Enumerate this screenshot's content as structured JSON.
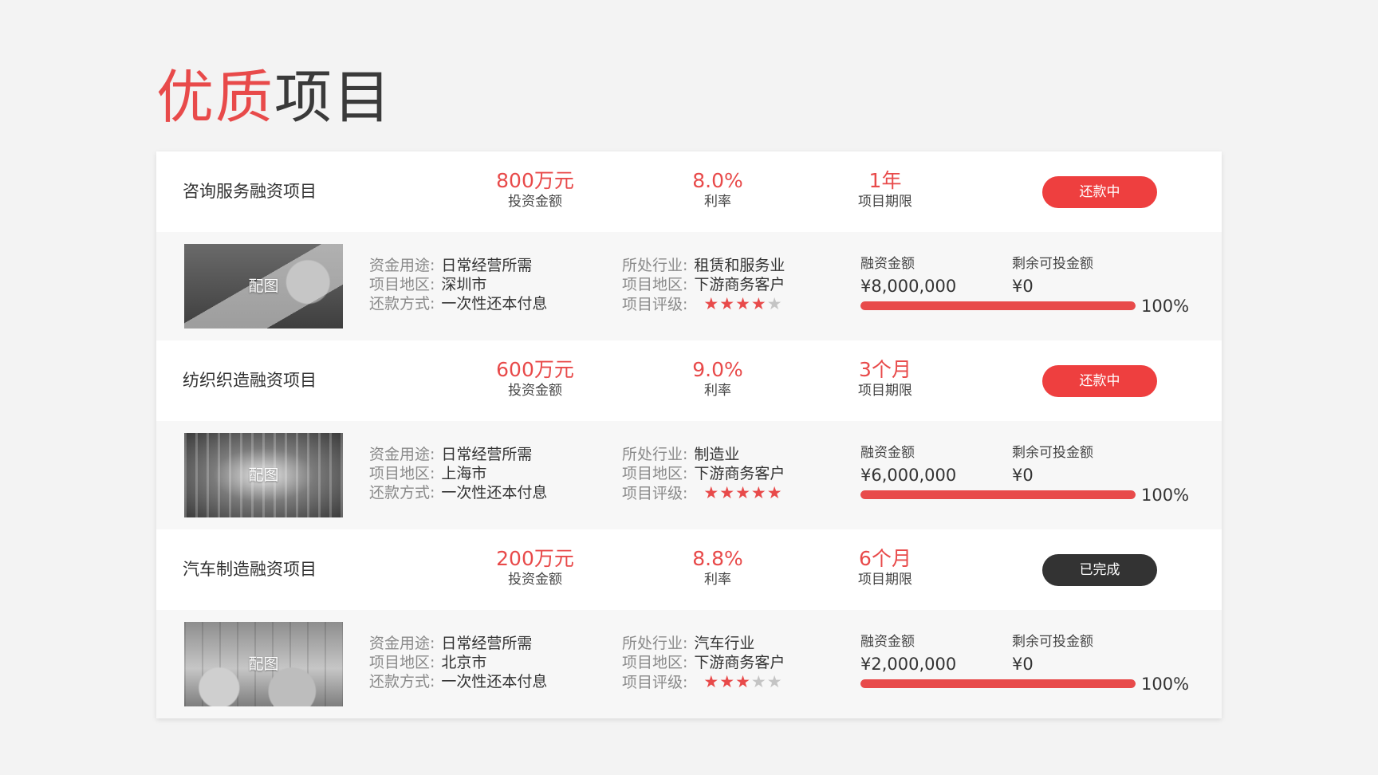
{
  "title": {
    "accent": "优质",
    "rest": "项目"
  },
  "projects": [
    {
      "name": "咨询服务融资项目",
      "amount": {
        "value": "800万元",
        "caption": "投资金额"
      },
      "rate": {
        "value": "8.0%",
        "caption": "利率"
      },
      "term": {
        "value": "1年",
        "caption": "项目期限"
      },
      "status": "还款中",
      "status_type": "active",
      "image_label": "配图",
      "purpose": {
        "key": "资金用途",
        "sep": ":",
        "value": "日常经营所需"
      },
      "region": {
        "key": "项目地区",
        "sep": ":",
        "value": "深圳市"
      },
      "repayment": {
        "key": "还款方式",
        "sep": ":",
        "value": "一次性还本付息"
      },
      "industry": {
        "key": "所处行业",
        "sep": ":",
        "value": "租赁和服务业"
      },
      "region2": {
        "key": "项目地区",
        "sep": ":",
        "value": "下游商务客户"
      },
      "rating": {
        "key": "项目评级",
        "sep": ":",
        "stars": 4,
        "max": 5
      },
      "financing_label": "融资金额",
      "financing_value": "¥8,000,000",
      "remaining_label": "剩余可投金额",
      "remaining_value": "¥0",
      "progress": 100,
      "progress_text": "100%"
    },
    {
      "name": "纺织织造融资项目",
      "amount": {
        "value": "600万元",
        "caption": "投资金额"
      },
      "rate": {
        "value": "9.0%",
        "caption": "利率"
      },
      "term": {
        "value": "3个月",
        "caption": "项目期限"
      },
      "status": "还款中",
      "status_type": "active",
      "image_label": "配图",
      "purpose": {
        "key": "资金用途",
        "sep": ":",
        "value": "日常经营所需"
      },
      "region": {
        "key": "项目地区",
        "sep": ":",
        "value": "上海市"
      },
      "repayment": {
        "key": "还款方式",
        "sep": ":",
        "value": "一次性还本付息"
      },
      "industry": {
        "key": "所处行业",
        "sep": ":",
        "value": "制造业"
      },
      "region2": {
        "key": "项目地区",
        "sep": ":",
        "value": "下游商务客户"
      },
      "rating": {
        "key": "项目评级",
        "sep": ":",
        "stars": 5,
        "max": 5
      },
      "financing_label": "融资金额",
      "financing_value": "¥6,000,000",
      "remaining_label": "剩余可投金额",
      "remaining_value": "¥0",
      "progress": 100,
      "progress_text": "100%"
    },
    {
      "name": "汽车制造融资项目",
      "amount": {
        "value": "200万元",
        "caption": "投资金额"
      },
      "rate": {
        "value": "8.8%",
        "caption": "利率"
      },
      "term": {
        "value": "6个月",
        "caption": "项目期限"
      },
      "status": "已完成",
      "status_type": "done",
      "image_label": "配图",
      "purpose": {
        "key": "资金用途",
        "sep": ":",
        "value": "日常经营所需"
      },
      "region": {
        "key": "项目地区",
        "sep": ":",
        "value": "北京市"
      },
      "repayment": {
        "key": "还款方式",
        "sep": ":",
        "value": "一次性还本付息"
      },
      "industry": {
        "key": "所处行业",
        "sep": ":",
        "value": "汽车行业"
      },
      "region2": {
        "key": "项目地区",
        "sep": ":",
        "value": "下游商务客户"
      },
      "rating": {
        "key": "项目评级",
        "sep": ":",
        "stars": 3,
        "max": 5
      },
      "financing_label": "融资金额",
      "financing_value": "¥2,000,000",
      "remaining_label": "剩余可投金额",
      "remaining_value": "¥0",
      "progress": 100,
      "progress_text": "100%"
    }
  ],
  "colors": {
    "accent": "#e84a4a",
    "status_active": "#ee3f3f",
    "status_done": "#333333",
    "star_off": "#c4c4c4",
    "background": "#f3f3f3"
  },
  "icons": {
    "star": "star-icon"
  }
}
